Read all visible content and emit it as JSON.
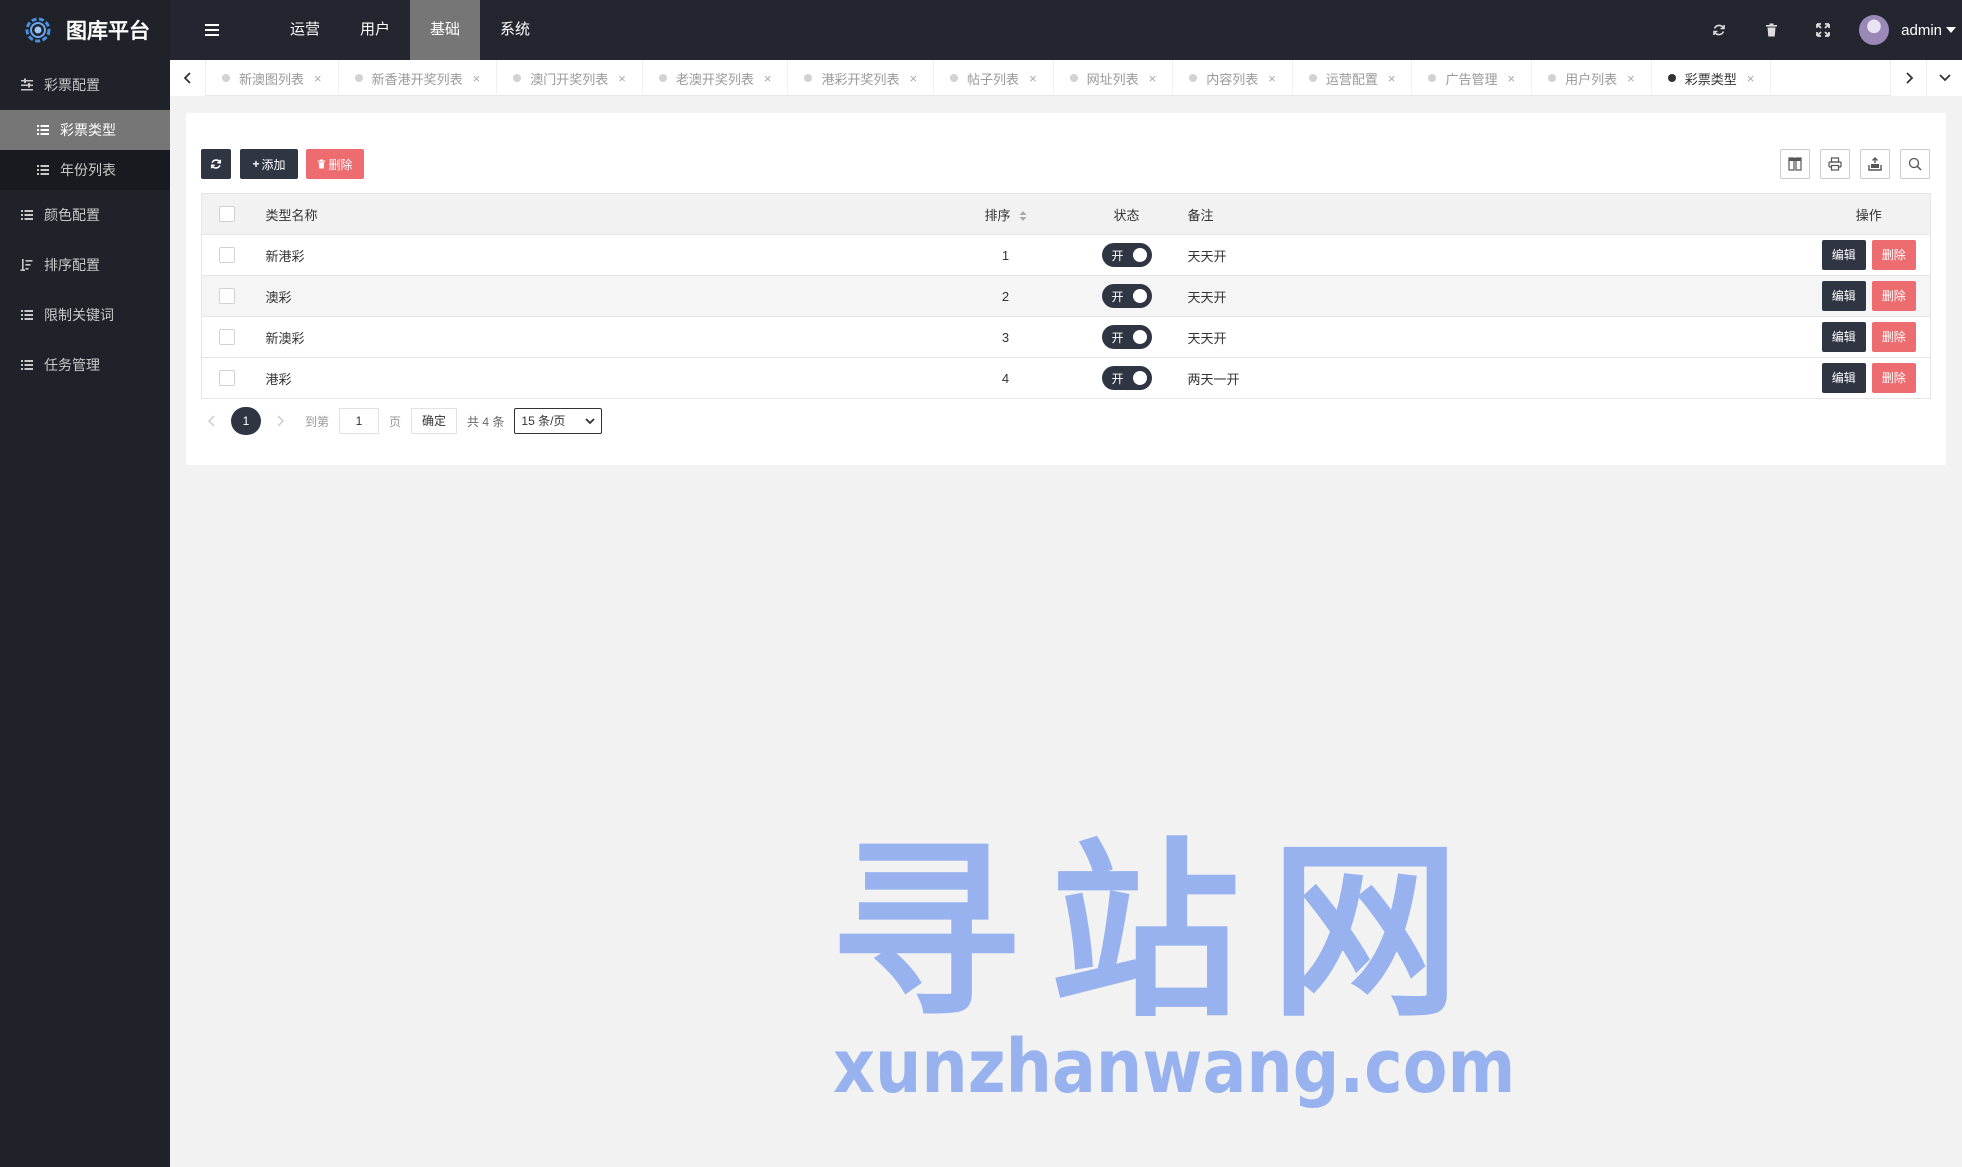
{
  "app": {
    "title": "图库平台"
  },
  "top_nav": {
    "items": [
      "运营",
      "用户",
      "基础",
      "系统"
    ],
    "active": "基础"
  },
  "user": {
    "name": "admin"
  },
  "sidebar": {
    "items": [
      {
        "label": "彩票配置",
        "icon": "sliders-icon"
      },
      {
        "label": "颜色配置",
        "icon": "list-icon"
      },
      {
        "label": "排序配置",
        "icon": "sort-icon"
      },
      {
        "label": "限制关键词",
        "icon": "list-icon"
      },
      {
        "label": "任务管理",
        "icon": "list-icon"
      }
    ],
    "sub_items": [
      {
        "label": "彩票类型",
        "active": true
      },
      {
        "label": "年份列表",
        "active": false
      }
    ]
  },
  "tabs": [
    "新澳图列表",
    "新香港开奖列表",
    "澳门开奖列表",
    "老澳开奖列表",
    "港彩开奖列表",
    "帖子列表",
    "网址列表",
    "内容列表",
    "运营配置",
    "广告管理",
    "用户列表",
    "彩票类型"
  ],
  "active_tab": "彩票类型",
  "toolbar": {
    "add_label": "添加",
    "delete_label": "删除"
  },
  "table": {
    "headers": {
      "name": "类型名称",
      "sort": "排序",
      "status": "状态",
      "note": "备注",
      "actions": "操作"
    },
    "rows": [
      {
        "name": "新港彩",
        "sort": "1",
        "status": "开",
        "note": "天天开"
      },
      {
        "name": "澳彩",
        "sort": "2",
        "status": "开",
        "note": "天天开"
      },
      {
        "name": "新澳彩",
        "sort": "3",
        "status": "开",
        "note": "天天开"
      },
      {
        "name": "港彩",
        "sort": "4",
        "status": "开",
        "note": "两天一开"
      }
    ],
    "edit_label": "编辑",
    "delete_label": "删除"
  },
  "pagination": {
    "current": "1",
    "goto_label": "到第",
    "goto_value": "1",
    "page_label": "页",
    "confirm_label": "确定",
    "total_label": "共 4 条",
    "page_size": "15 条/页"
  },
  "watermark": {
    "cn": "寻站网",
    "en": "xunzhanwang.com"
  },
  "colors": {
    "sidebar_bg": "#20222a",
    "header_bg": "#23262e",
    "active_nav": "#767676",
    "primary_btn": "#2f3542",
    "danger_btn": "#ec6c70",
    "watermark": "#97b2ee"
  }
}
